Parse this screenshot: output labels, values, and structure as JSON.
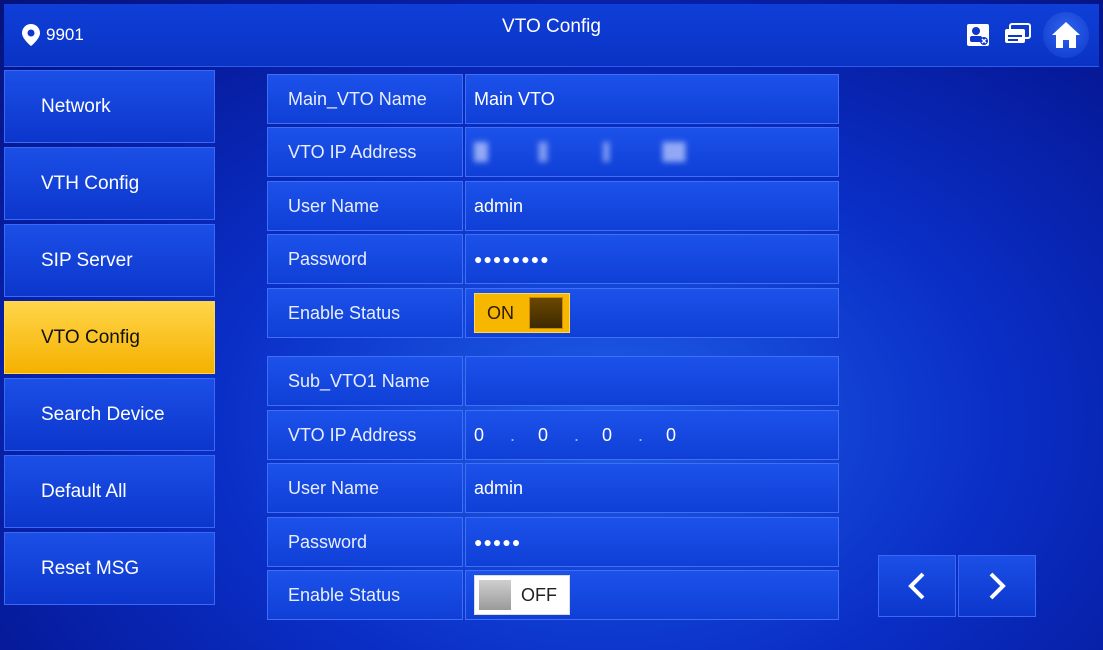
{
  "header": {
    "location": "9901",
    "title": "VTO Config",
    "icons": [
      "pin-icon",
      "contact-icon",
      "message-icon",
      "home-icon"
    ]
  },
  "sidebar": {
    "items": [
      {
        "label": "Network"
      },
      {
        "label": "VTH Config"
      },
      {
        "label": "SIP Server"
      },
      {
        "label": "VTO Config",
        "active": true
      },
      {
        "label": "Search Device"
      },
      {
        "label": "Default All"
      },
      {
        "label": "Reset MSG"
      }
    ]
  },
  "main_vto": {
    "name_label": "Main_VTO Name",
    "name_value": "Main VTO",
    "ip_label": "VTO IP Address",
    "user_label": "User Name",
    "user_value": "admin",
    "password_label": "Password",
    "password_value": "●●●●●●●●",
    "enable_label": "Enable Status",
    "enable_value": "ON"
  },
  "sub_vto1": {
    "name_label": "Sub_VTO1 Name",
    "name_value": "",
    "ip_label": "VTO IP Address",
    "ip_octets": [
      "0",
      "0",
      "0",
      "0"
    ],
    "ip_separator": ".",
    "user_label": "User Name",
    "user_value": "admin",
    "password_label": "Password",
    "password_value": "●●●●●",
    "enable_label": "Enable Status",
    "enable_value": "OFF"
  },
  "colors": {
    "accent_active": "#f5b100",
    "panel_blue": "#0f3fd6"
  }
}
